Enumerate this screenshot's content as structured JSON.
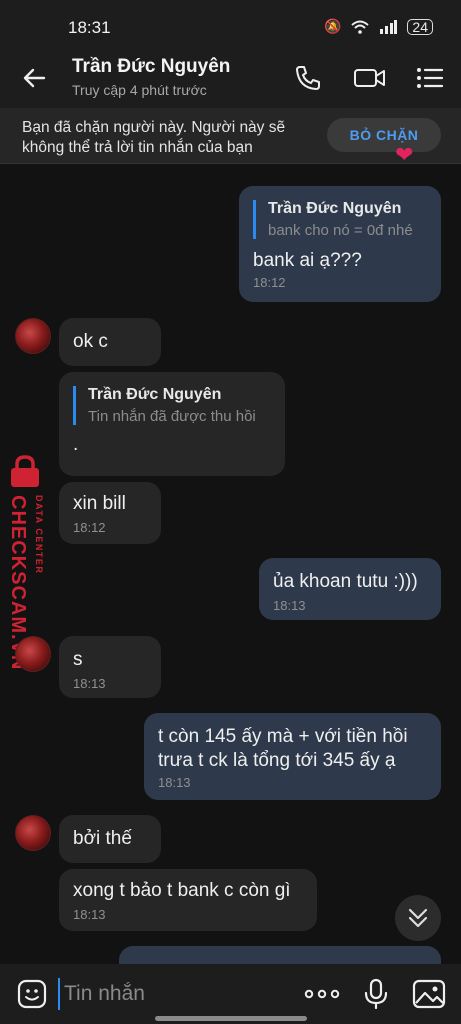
{
  "status_bar": {
    "time": "18:31",
    "battery": "24"
  },
  "header": {
    "name": "Trần Đức Nguyên",
    "status": "Truy cập 4 phút trước"
  },
  "banner": {
    "text": "Bạn đã chặn người này. Người này sẽ không thể trả lời tin nhắn của bạn",
    "button": "BỎ CHẶN"
  },
  "messages": {
    "m1": {
      "quote_name": "Trần Đức Nguyên",
      "quote_text": "bank cho nó = 0đ nhé",
      "text": "bank ai ạ???",
      "time": "18:12"
    },
    "m2": {
      "text": "ok c"
    },
    "m3": {
      "quote_name": "Trần Đức Nguyên",
      "quote_text": "Tin nhắn đã được thu hồi",
      "text": "."
    },
    "m4": {
      "text": "xin bill",
      "time": "18:12"
    },
    "m5": {
      "text": "ủa khoan tutu :)))",
      "time": "18:13"
    },
    "m6": {
      "text": "s",
      "time": "18:13"
    },
    "m7": {
      "line1": "t còn 145 ấy mà + với tiền hồi",
      "line2": "trưa t ck là tổng tới 345 ấy ạ",
      "time": "18:13"
    },
    "m8": {
      "text": "bởi thế"
    },
    "m9": {
      "text": "xong t bảo t bank c còn gì",
      "time": "18:13"
    }
  },
  "watermark": {
    "brand": "CHECKSCAM.VN",
    "sub": "DATA CENTER"
  },
  "input": {
    "placeholder": "Tin nhắn"
  },
  "icons": {
    "back": "back-arrow-icon",
    "call": "phone-icon",
    "video": "video-camera-icon",
    "menu": "menu-icon",
    "sticker": "sticker-icon",
    "more": "more-icon",
    "mic": "microphone-icon",
    "image": "image-icon",
    "scroll": "chevron-double-down-icon"
  },
  "colors": {
    "accent": "#2b8af0",
    "outgoing_bubble": "#2e3a4c",
    "incoming_bubble": "#262626",
    "watermark": "#cf2333"
  }
}
